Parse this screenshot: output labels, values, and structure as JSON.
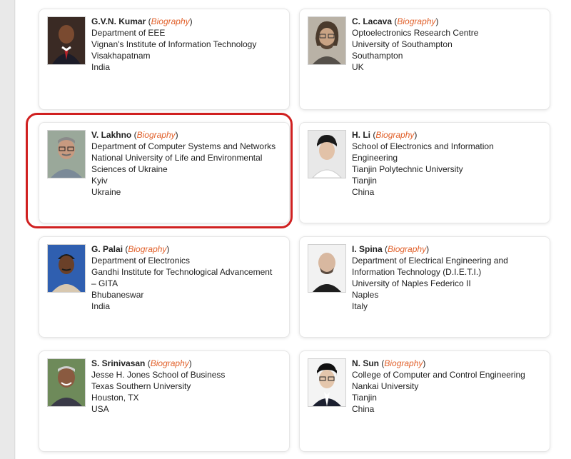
{
  "colors": {
    "accent": "#e1602a",
    "highlight_border": "#d02020"
  },
  "cards": [
    {
      "name": "G.V.N. Kumar",
      "bio_label": "Biography",
      "lines": [
        "Department of EEE",
        "Vignan's Institute of Information Technology",
        "Visakhapatnam",
        "India"
      ],
      "photo": "portrait-suit-tie"
    },
    {
      "name": "C. Lacava",
      "bio_label": "Biography",
      "lines": [
        "Optoelectronics Research Centre",
        "University of Southampton",
        "Southampton",
        "UK"
      ],
      "photo": "portrait-glasses-beard"
    },
    {
      "name": "V. Lakhno",
      "bio_label": "Biography",
      "lines": [
        "Department of Computer Systems and Networks",
        "National University of Life and Environmental",
        "Sciences of Ukraine",
        "Kyiv",
        "Ukraine"
      ],
      "photo": "portrait-glasses-mustache"
    },
    {
      "name": "H. Li",
      "bio_label": "Biography",
      "lines": [
        "School of Electronics and Information",
        "Engineering",
        "Tianjin Polytechnic University",
        "Tianjin",
        "China"
      ],
      "photo": "portrait-white-shirt"
    },
    {
      "name": "G. Palai",
      "bio_label": "Biography",
      "lines": [
        "Department of Electronics",
        "Gandhi Institute for Technological Advancement",
        "– GITA",
        "Bhubaneswar",
        "India"
      ],
      "photo": "portrait-blue-background"
    },
    {
      "name": "I. Spina",
      "bio_label": "Biography",
      "lines": [
        "Department of Electrical Engineering and",
        "Information Technology (D.I.E.T.I.)",
        "University of Naples Federico II",
        "Naples",
        "Italy"
      ],
      "photo": "portrait-shaved-head"
    },
    {
      "name": "S. Srinivasan",
      "bio_label": "Biography",
      "lines": [
        "Jesse H. Jones School of Business",
        "Texas Southern University",
        "Houston, TX",
        "USA"
      ],
      "photo": "portrait-outdoor-smiling"
    },
    {
      "name": "N. Sun",
      "bio_label": "Biography",
      "lines": [
        "College of Computer and Control Engineering",
        "Nankai University",
        "Tianjin",
        "China"
      ],
      "photo": "portrait-glasses-suit"
    }
  ]
}
